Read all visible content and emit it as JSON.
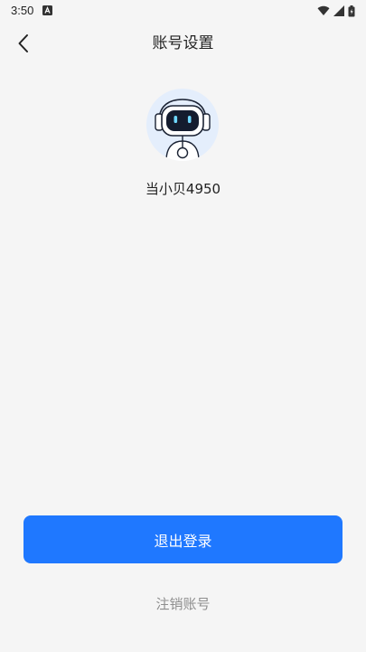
{
  "status_bar": {
    "time": "3:50",
    "notification_icon": "a-icon",
    "icons": [
      "wifi-icon",
      "signal-icon",
      "battery-icon"
    ]
  },
  "header": {
    "back_icon": "chevron-left-icon",
    "title": "账号设置"
  },
  "profile": {
    "avatar_icon": "robot-avatar-icon",
    "username": "当小贝4950"
  },
  "actions": {
    "logout_label": "退出登录",
    "deregister_label": "注销账号"
  },
  "colors": {
    "primary": "#1f78ff",
    "avatar_bg": "#e4eefc",
    "page_bg": "#f5f5f5",
    "secondary_text": "#8e8e8e"
  }
}
